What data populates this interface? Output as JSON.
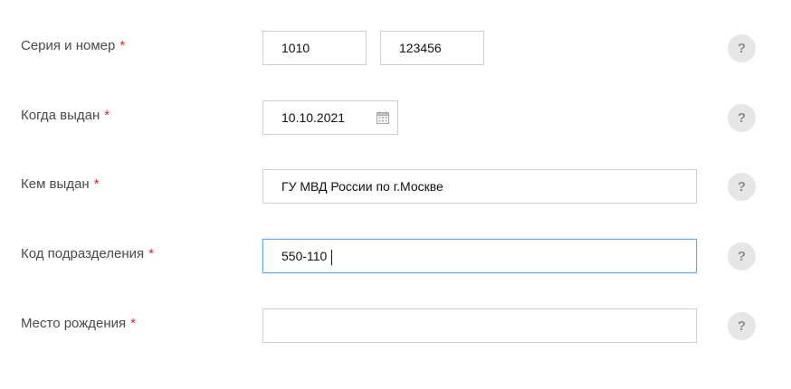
{
  "form": {
    "passport_series_number": {
      "label": "Серия и номер",
      "required_mark": "*",
      "series_value": "1010",
      "number_value": "123456"
    },
    "issue_date": {
      "label": "Когда выдан",
      "required_mark": "*",
      "value": "10.10.2021",
      "icon": "calendar-icon"
    },
    "issued_by": {
      "label": "Кем выдан",
      "required_mark": "*",
      "value": "ГУ МВД России по г.Москве"
    },
    "department_code": {
      "label": "Код подразделения",
      "required_mark": "*",
      "value": "550-110"
    },
    "birth_place": {
      "label": "Место рождения",
      "required_mark": "*",
      "value": ""
    },
    "help_label": "?"
  },
  "colors": {
    "required": "#e0262b",
    "focus_border": "#68a9e3",
    "field_border": "#cfcfcf",
    "help_bg": "#e6e6e6"
  }
}
